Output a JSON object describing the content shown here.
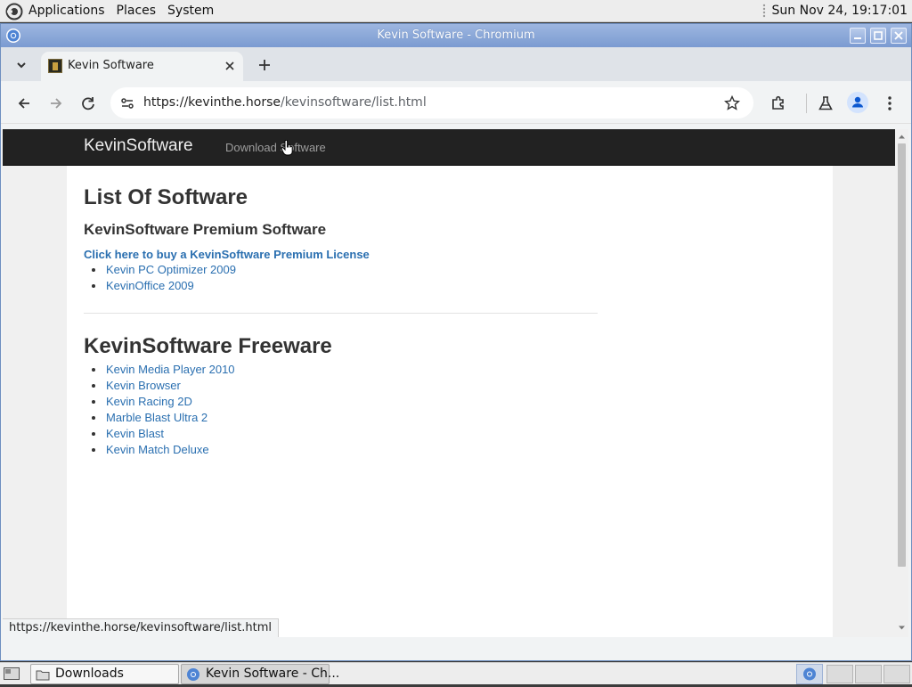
{
  "top_panel": {
    "menus": [
      "Applications",
      "Places",
      "System"
    ],
    "clock": "Sun Nov 24, 19:17:01"
  },
  "window": {
    "title": "Kevin Software - Chromium"
  },
  "tabs": [
    {
      "title": "Kevin Software"
    }
  ],
  "omnibox": {
    "url_host": "https://kevinthe.horse",
    "url_path": "/kevinsoftware/list.html"
  },
  "page": {
    "navbar": {
      "brand": "KevinSoftware",
      "links": [
        "Download Software"
      ]
    },
    "heading": "List Of Software",
    "premium": {
      "heading": "KevinSoftware Premium Software",
      "buy_link": "Click here to buy a KevinSoftware Premium License",
      "items": [
        "Kevin PC Optimizer 2009",
        "KevinOffice 2009"
      ]
    },
    "freeware": {
      "heading": "KevinSoftware Freeware",
      "items": [
        "Kevin Media Player 2010",
        "Kevin Browser",
        "Kevin Racing 2D",
        "Marble Blast Ultra 2",
        "Kevin Blast",
        "Kevin Match Deluxe"
      ]
    }
  },
  "status_bubble": "https://kevinthe.horse/kevinsoftware/list.html",
  "taskbar": {
    "tasks": [
      "Downloads",
      "Kevin Software - Ch..."
    ]
  },
  "colors": {
    "link": "#2a6fb0",
    "navbar_bg": "#222222",
    "titlebar": "#7b9bd1"
  }
}
